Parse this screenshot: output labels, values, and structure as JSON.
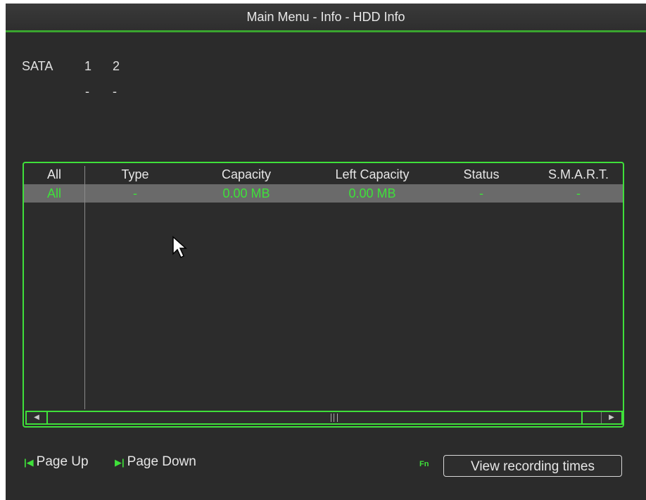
{
  "window": {
    "title": "Main Menu - Info - HDD Info"
  },
  "sata": {
    "label": "SATA",
    "ports": [
      "1",
      "2"
    ],
    "status": [
      "-",
      "-"
    ]
  },
  "table": {
    "headers": [
      "All",
      "Type",
      "Capacity",
      "Left Capacity",
      "Status",
      "S.M.A.R.T."
    ],
    "rows": [
      [
        "All",
        "-",
        "0.00 MB",
        "0.00 MB",
        "-",
        "-"
      ]
    ]
  },
  "footer": {
    "page_up": "Page Up",
    "page_down": "Page Down",
    "fn": "Fn",
    "view_recording_times": "View recording times"
  },
  "colors": {
    "accent": "#3fe03a",
    "background": "#2b2b2b",
    "selected_row": "#6a6a6a"
  }
}
